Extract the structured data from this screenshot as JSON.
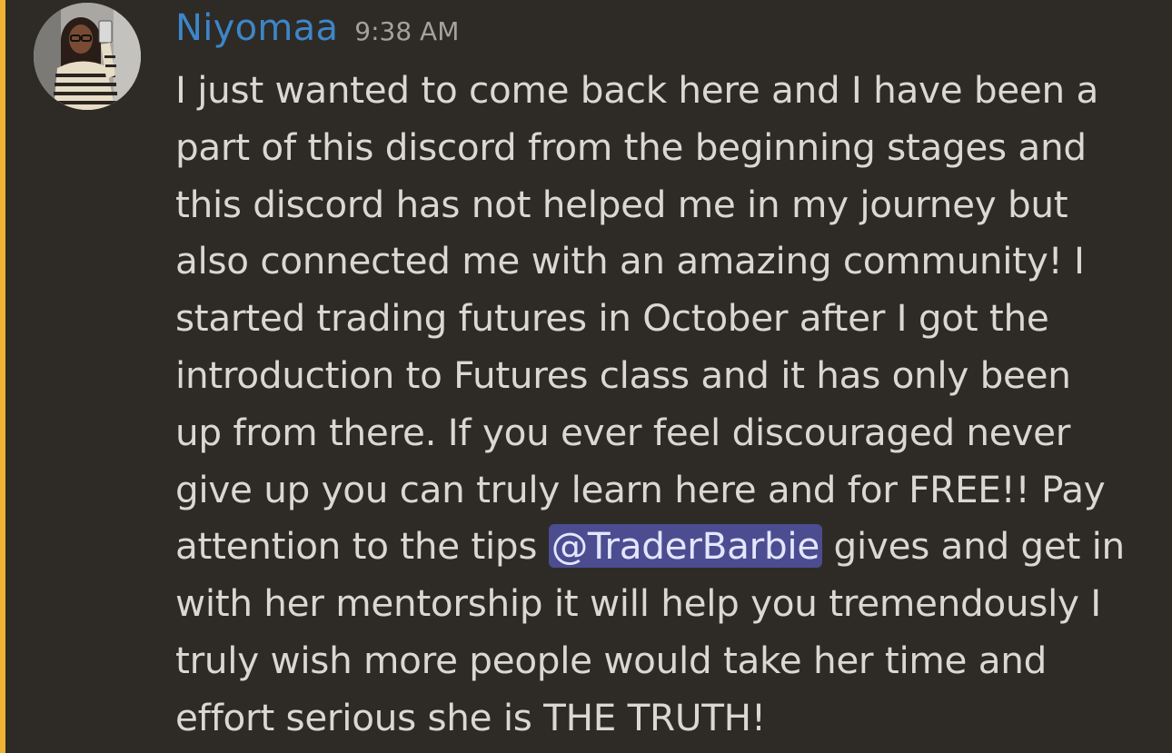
{
  "colors": {
    "background": "#2e2b26",
    "highlight_bar": "#f0b232",
    "username": "#3d86c9",
    "timestamp": "#a6a29b",
    "text": "#dbd8d3",
    "mention_bg": "#4b4d90"
  },
  "message": {
    "author": "Niyomaa",
    "timestamp": "9:38 AM",
    "avatar_icon": "user-avatar-photo",
    "lines": [
      "I just wanted to come back here and I have been a",
      "part of this discord from the beginning stages and",
      "this discord has not helped me in my journey but",
      "also connected me with an amazing community! I",
      "started trading futures in October after I got the",
      "introduction to Futures class and it has only been",
      "up from there. If you ever feel discouraged never",
      "give up you can truly learn here and for FREE!! Pay"
    ],
    "mention_line": {
      "before": "attention to the tips ",
      "mention": "@TraderBarbie",
      "after": " gives and get in"
    },
    "lines_after": [
      "with her mentorship it will help you tremendously I",
      "truly wish more people would take her time and",
      "effort serious she is THE TRUTH!"
    ]
  }
}
